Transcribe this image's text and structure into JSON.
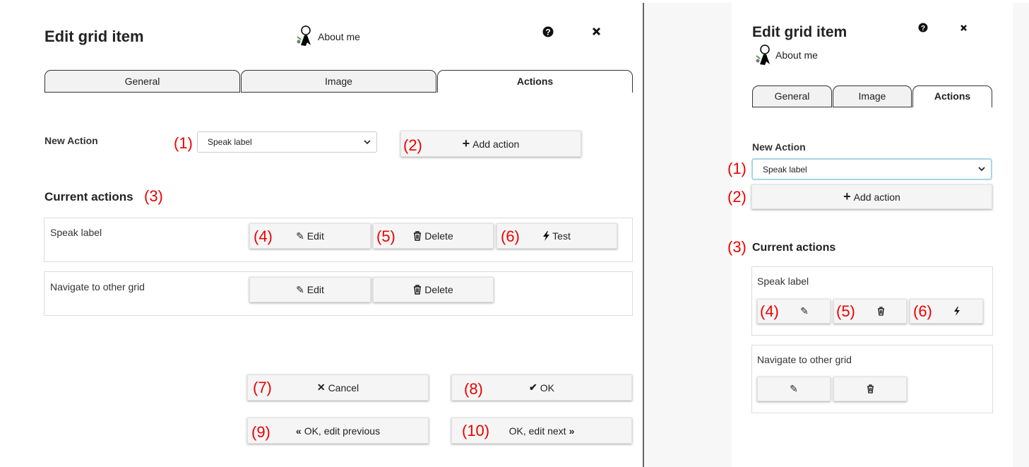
{
  "wide": {
    "title": "Edit grid item",
    "item_label": "About me",
    "tabs": [
      {
        "label": "General"
      },
      {
        "label": "Image"
      },
      {
        "label": "Actions",
        "active": true
      }
    ],
    "new_action_label": "New Action",
    "select_value": "Speak label",
    "add_action_label": "Add action",
    "current_actions_label": "Current actions",
    "actions": [
      {
        "name": "Speak label",
        "edit": "Edit",
        "delete": "Delete",
        "test": "Test"
      },
      {
        "name": "Navigate to other grid",
        "edit": "Edit",
        "delete": "Delete"
      }
    ],
    "footer": {
      "cancel": "Cancel",
      "ok": "OK",
      "ok_prev": "OK, edit previous",
      "ok_next": "OK, edit next"
    }
  },
  "narrow": {
    "title": "Edit grid item",
    "item_label": "About me",
    "tabs": [
      {
        "label": "General"
      },
      {
        "label": "Image"
      },
      {
        "label": "Actions",
        "active": true
      }
    ],
    "new_action_label": "New Action",
    "select_value": "Speak label",
    "add_action_label": "Add action",
    "current_actions_label": "Current actions",
    "actions": [
      {
        "name": "Speak label"
      },
      {
        "name": "Navigate to other grid"
      }
    ]
  },
  "annotations": [
    "(1)",
    "(2)",
    "(3)",
    "(4)",
    "(5)",
    "(6)",
    "(7)",
    "(8)",
    "(9)",
    "(10)"
  ],
  "colors": {
    "annotation": "#e00000",
    "focus_ring": "#a8d4e6",
    "side_background": "#f7f7f7"
  }
}
